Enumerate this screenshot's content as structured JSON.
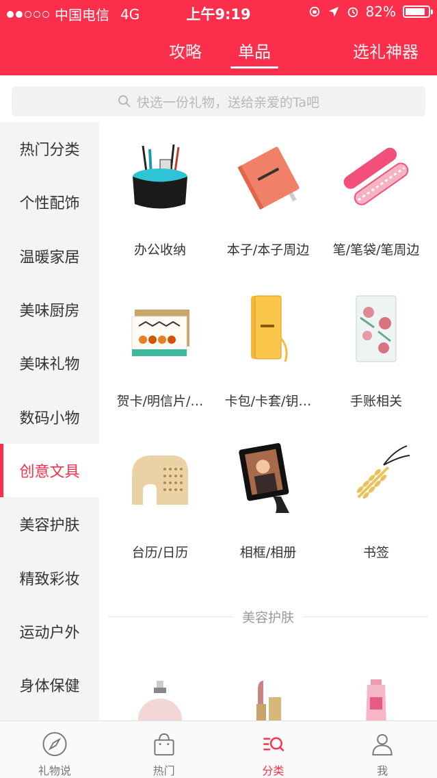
{
  "status_bar": {
    "carrier": "中国电信",
    "network": "4G",
    "time": "上午9:19",
    "battery": "82%",
    "battery_level": 0.82
  },
  "top_tabs": [
    {
      "label": "攻略",
      "active": false
    },
    {
      "label": "单品",
      "active": true
    },
    {
      "label": "选礼神器",
      "active": false
    }
  ],
  "search": {
    "placeholder": "快选一份礼物，送给亲爱的Ta吧",
    "icon": "search-icon"
  },
  "sidebar": {
    "items": [
      {
        "label": "热门分类",
        "active": false
      },
      {
        "label": "个性配饰",
        "active": false
      },
      {
        "label": "温暖家居",
        "active": false
      },
      {
        "label": "美味厨房",
        "active": false
      },
      {
        "label": "美味礼物",
        "active": false
      },
      {
        "label": "数码小物",
        "active": false
      },
      {
        "label": "创意文具",
        "active": true
      },
      {
        "label": "美容护肤",
        "active": false
      },
      {
        "label": "精致彩妆",
        "active": false
      },
      {
        "label": "运动户外",
        "active": false
      },
      {
        "label": "身体保健",
        "active": false
      }
    ]
  },
  "grid": {
    "items": [
      {
        "label": "办公收纳",
        "image": "desk-organizer"
      },
      {
        "label": "本子/本子周边",
        "image": "notebook"
      },
      {
        "label": "笔/笔袋/笔周边",
        "image": "pencil-case"
      },
      {
        "label": "贺卡/明信片/…",
        "image": "greeting-card"
      },
      {
        "label": "卡包/卡套/钥…",
        "image": "card-wallet"
      },
      {
        "label": "手账相关",
        "image": "journal"
      },
      {
        "label": "台历/日历",
        "image": "desk-calendar"
      },
      {
        "label": "相框/相册",
        "image": "photo-frame"
      },
      {
        "label": "书签",
        "image": "bookmark"
      }
    ]
  },
  "section": {
    "title": "美容护肤"
  },
  "peek_items": [
    {
      "image": "perfume-bottle"
    },
    {
      "image": "lipstick"
    },
    {
      "image": "lotion-tube"
    }
  ],
  "bottom_nav": [
    {
      "label": "礼物说",
      "icon": "compass-icon",
      "active": false
    },
    {
      "label": "热门",
      "icon": "shopping-bag-icon",
      "active": false
    },
    {
      "label": "分类",
      "icon": "category-search-icon",
      "active": true
    },
    {
      "label": "我",
      "icon": "person-icon",
      "active": false
    }
  ],
  "colors": {
    "brand": "#fb2e4c",
    "sidebar_bg": "#f4f4f4",
    "text": "#333333",
    "muted": "#999999"
  }
}
